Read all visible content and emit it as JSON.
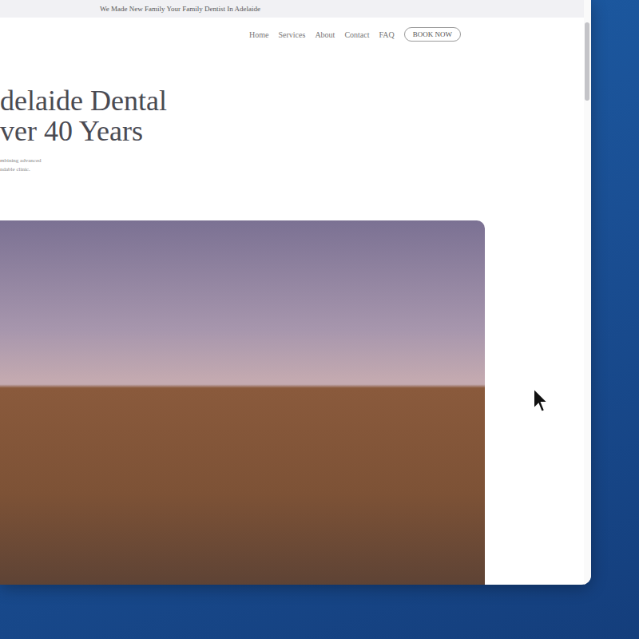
{
  "banner": "We Made New Family Your Family Dentist In Adelaide",
  "nav": {
    "items": [
      {
        "label": "Home"
      },
      {
        "label": "Services"
      },
      {
        "label": "About"
      },
      {
        "label": "Contact"
      },
      {
        "label": "FAQ"
      }
    ],
    "cta": "BOOK NOW"
  },
  "hero": {
    "title_lines": [
      "delaide Dental",
      "ver 40 Years"
    ],
    "subtitle_lines": [
      "mbining advanced",
      "ndable clinic."
    ]
  },
  "scrollbar": {
    "level": 0.14
  }
}
